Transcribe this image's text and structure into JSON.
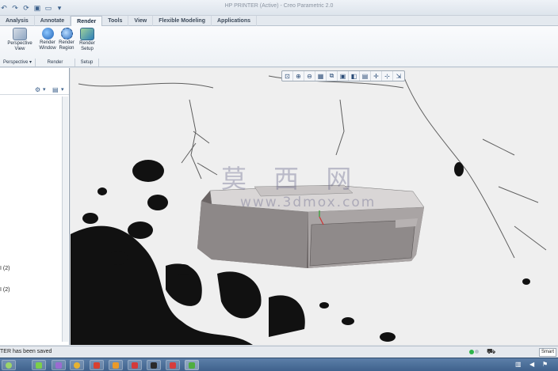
{
  "window": {
    "title": "HP PRINTER (Active) - Creo Parametric 2.0"
  },
  "tabs": [
    {
      "label": "Analysis"
    },
    {
      "label": "Annotate"
    },
    {
      "label": "Render",
      "active": true
    },
    {
      "label": "Tools"
    },
    {
      "label": "View"
    },
    {
      "label": "Flexible Modeling"
    },
    {
      "label": "Applications"
    }
  ],
  "ribbon": {
    "buttons": [
      {
        "label1": "Perspective",
        "label2": "View"
      },
      {
        "label1": "Render",
        "label2": "Window"
      },
      {
        "label1": "Render",
        "label2": "Region"
      },
      {
        "label1": "Render",
        "label2": "Setup"
      }
    ],
    "groups": [
      {
        "label": "Perspective ▾"
      },
      {
        "label": "Render"
      },
      {
        "label": "Setup"
      }
    ]
  },
  "tree": {
    "items": [
      {
        "label": "I (2)"
      },
      {
        "label": "I (2)"
      }
    ]
  },
  "status": {
    "message": "TER has been saved",
    "filter": "Smart"
  },
  "watermark": {
    "chars": "莫 西 网",
    "url": "www.3dmox.com"
  },
  "colors": {
    "ribbon_bg": "#f3f5f8",
    "accent": "#3b6ea5",
    "taskbar": "#4a6d98"
  }
}
